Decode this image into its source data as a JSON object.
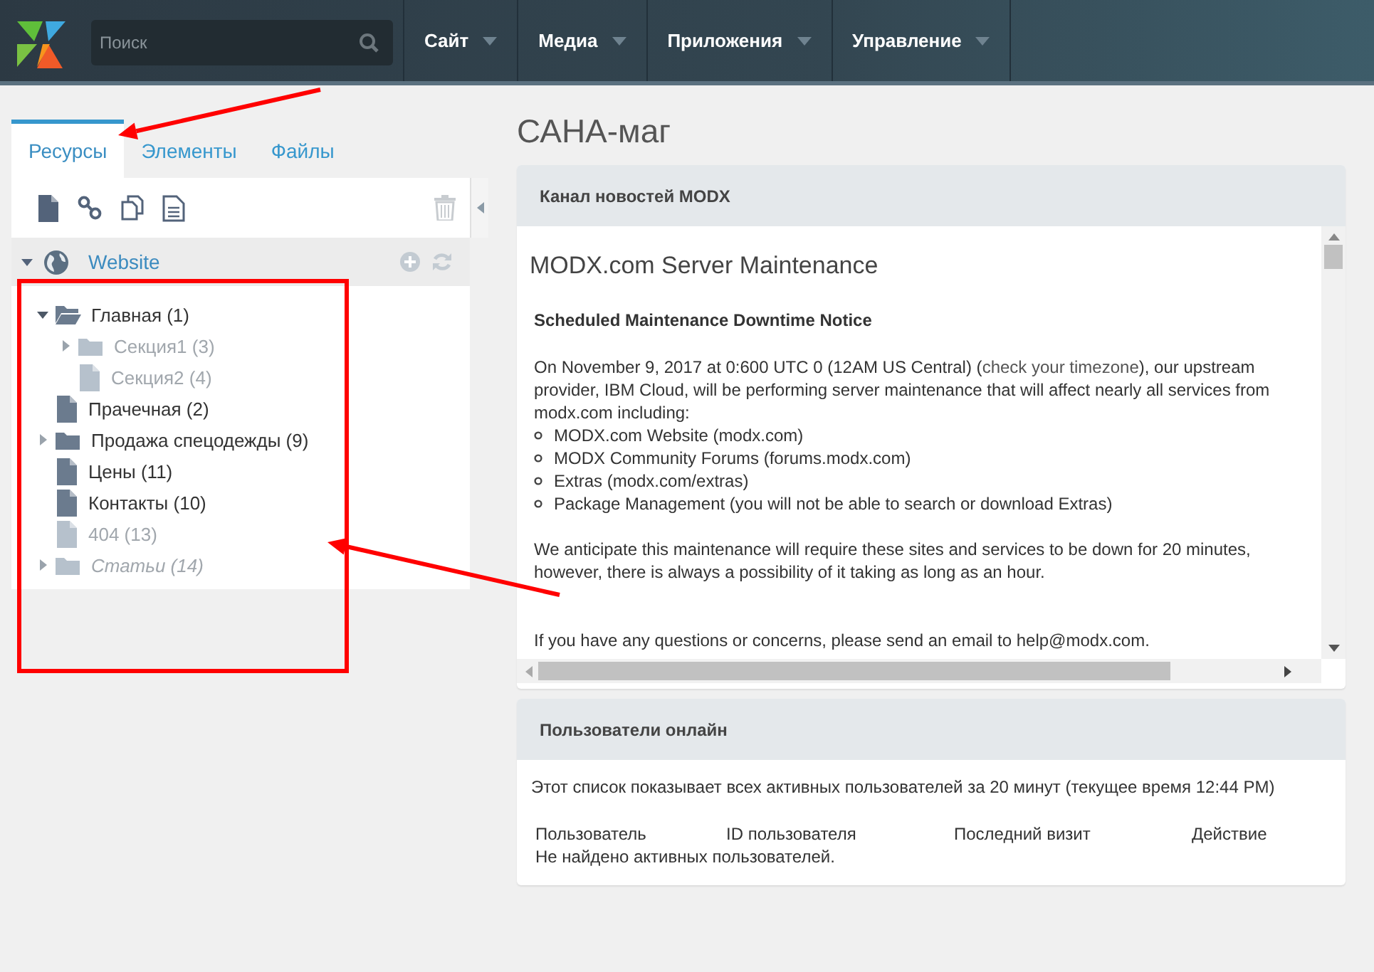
{
  "topbar": {
    "search": {
      "placeholder": "Поиск"
    },
    "menu": [
      {
        "label": "Сайт"
      },
      {
        "label": "Медиа"
      },
      {
        "label": "Приложения"
      },
      {
        "label": "Управление"
      }
    ]
  },
  "sidebar": {
    "tabs": [
      {
        "label": "Ресурсы",
        "selected": true
      },
      {
        "label": "Элементы",
        "selected": false
      },
      {
        "label": "Файлы",
        "selected": false
      }
    ],
    "root": {
      "label": "Website",
      "expanded": true
    },
    "tree": [
      {
        "label": "Главная (1)",
        "kind": "folder",
        "expanded": true,
        "published": true,
        "hidden": false,
        "children": [
          {
            "label": "Секция1 (3)",
            "kind": "folder",
            "expanded": false,
            "published": false,
            "hidden": false
          },
          {
            "label": "Секция2 (4)",
            "kind": "document",
            "published": false,
            "hidden": false
          }
        ]
      },
      {
        "label": "Прачечная (2)",
        "kind": "document",
        "published": true,
        "hidden": false
      },
      {
        "label": "Продажа спецодежды (9)",
        "kind": "folder",
        "expanded": false,
        "published": true,
        "hidden": false
      },
      {
        "label": "Цены (11)",
        "kind": "document",
        "published": true,
        "hidden": false
      },
      {
        "label": "Контакты (10)",
        "kind": "document",
        "published": true,
        "hidden": false
      },
      {
        "label": "404 (13)",
        "kind": "document",
        "published": false,
        "hidden": false
      },
      {
        "label": "Статьи (14)",
        "kind": "folder",
        "expanded": false,
        "published": false,
        "hidden": true
      }
    ]
  },
  "page_title": "САНА-маг",
  "news": {
    "title": "Канал новостей MODX",
    "heading": "MODX.com Server Maintenance",
    "subheading": "Scheduled Maintenance Downtime Notice",
    "intro": {
      "before": "On November 9, 2017 at 0:600 UTC 0 (12AM US Central) (",
      "link": "check your timezone",
      "after": "), our upstream provider, IBM Cloud, will be performing server maintenance that will affect nearly all services from modx.com including:"
    },
    "list": [
      "MODX.com Website (modx.com)",
      "MODX Community Forums (forums.modx.com)",
      "Extras (modx.com/extras)",
      "Package Management (you will not be able to search or download Extras)"
    ],
    "paragraphs": [
      "We anticipate this maintenance will require these sites and services to be down for 20 minutes, however, there is always a possibility of it taking as long as an hour.",
      "If you have any questions or concerns, please send an email to help@modx.com."
    ]
  },
  "online": {
    "title": "Пользователи онлайн",
    "description": "Этот список показывает всех активных пользователей за 20 минут (текущее время 12:44 PM)",
    "columns": [
      "Пользователь",
      "ID пользователя",
      "Последний визит",
      "Действие"
    ],
    "empty": "Не найдено активных пользователей."
  },
  "annotations": [
    {
      "kind": "arrow"
    },
    {
      "kind": "rectangle"
    },
    {
      "kind": "arrow"
    }
  ]
}
